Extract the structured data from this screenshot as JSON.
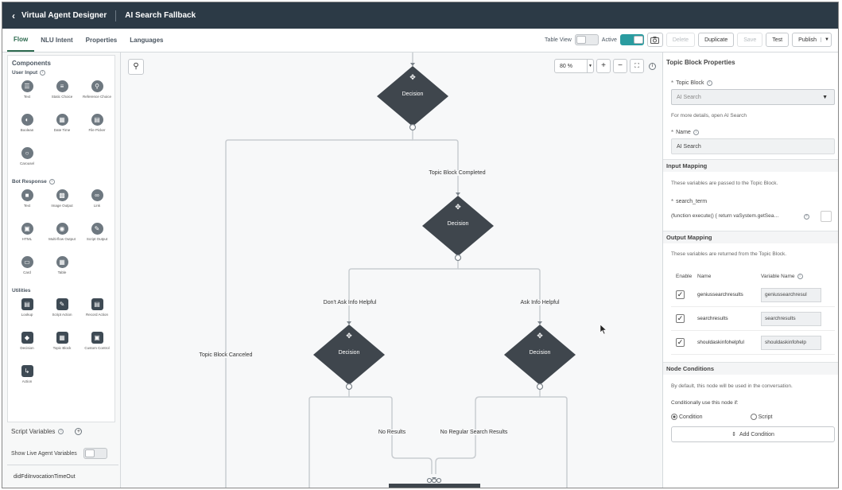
{
  "titlebar": {
    "back_icon": "chevron-left-icon",
    "app_title": "Virtual Agent Designer",
    "page_title": "AI Search Fallback"
  },
  "tabs": [
    {
      "label": "Flow",
      "active": true
    },
    {
      "label": "NLU Intent"
    },
    {
      "label": "Properties"
    },
    {
      "label": "Languages"
    }
  ],
  "toolbar": {
    "table_view_label": "Table View",
    "table_view_on": false,
    "active_label": "Active",
    "active_on": true,
    "delete_label": "Delete",
    "duplicate_label": "Duplicate",
    "save_label": "Save",
    "test_label": "Test",
    "publish_label": "Publish"
  },
  "components": {
    "title": "Components",
    "groups": [
      {
        "title": "User Input",
        "items": [
          "Text",
          "Static Choice",
          "Reference Choice",
          "Boolean",
          "Date Time",
          "File Picker",
          "Carousel"
        ]
      },
      {
        "title": "Bot Response",
        "items": [
          "Text",
          "Image Output",
          "Link",
          "HTML",
          "Multi-flow Output",
          "Script Output",
          "Card",
          "Table"
        ]
      },
      {
        "title": "Utilities",
        "items": [
          "Lookup",
          "Script Action",
          "Record Action",
          "Decision",
          "Topic Block",
          "Custom Control",
          "Action"
        ]
      }
    ]
  },
  "script_variables": {
    "label": "Script Variables",
    "live_agent_label": "Show Live Agent Variables",
    "variable": "didFdiInvocationTimeOut"
  },
  "canvas": {
    "zoom": "80 %",
    "nodes": [
      {
        "label": "Decision"
      },
      {
        "label": "Decision"
      },
      {
        "label": "Decision"
      },
      {
        "label": "Decision"
      }
    ],
    "edge_labels": [
      "Topic Block Completed",
      "Topic Block Canceled",
      "Don't Ask Info Helpful",
      "Ask Info Helpful",
      "No Results",
      "No Regular Search Results"
    ]
  },
  "panel": {
    "title": "Topic Block Properties",
    "topic_block_label": "Topic Block",
    "topic_block_value": "AI Search",
    "topic_block_help": "For more details, open AI Search",
    "name_label": "Name",
    "name_value": "AI Search",
    "input_mapping_title": "Input Mapping",
    "input_mapping_help": "These variables are passed to the Topic Block.",
    "search_term_label": "search_term",
    "search_term_value": "(function execute() { return vaSystem.getSea…",
    "output_mapping_title": "Output Mapping",
    "output_mapping_help": "These variables are returned from the Topic Block.",
    "col_enable": "Enable",
    "col_name": "Name",
    "col_variable": "Variable Name",
    "rows": [
      {
        "name": "geniussearchresults",
        "variable": "geniussearchresul"
      },
      {
        "name": "searchresults",
        "variable": "searchresults"
      },
      {
        "name": "shouldaskinfohelpful",
        "variable": "shouldaskinfohelp"
      }
    ],
    "node_conditions_title": "Node Conditions",
    "node_conditions_help": "By default, this node will be used in the conversation.",
    "conditional_label": "Conditionally use this node if:",
    "condition_label": "Condition",
    "script_label": "Script",
    "add_condition_label": "Add Condition"
  }
}
